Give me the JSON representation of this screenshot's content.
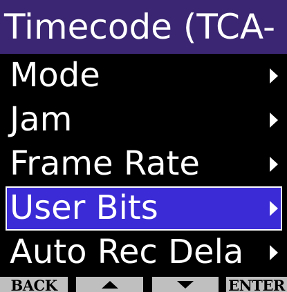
{
  "header": {
    "title": "Timecode (TCA-"
  },
  "menu": {
    "items": [
      {
        "label": "Mode",
        "selected": false
      },
      {
        "label": "Jam",
        "selected": false
      },
      {
        "label": "Frame Rate",
        "selected": false
      },
      {
        "label": "User Bits",
        "selected": true
      },
      {
        "label": "Auto Rec Dela",
        "selected": false
      }
    ]
  },
  "footer": {
    "back_label": "BACK",
    "up_icon": "up-arrow-icon",
    "down_icon": "down-arrow-icon",
    "enter_label": "ENTER"
  },
  "colors": {
    "title_bg": "#3a2672",
    "selected_bg": "#3b2bd6",
    "footer_button_bg": "#bfbfbf",
    "background": "#000000",
    "text": "#ffffff"
  }
}
